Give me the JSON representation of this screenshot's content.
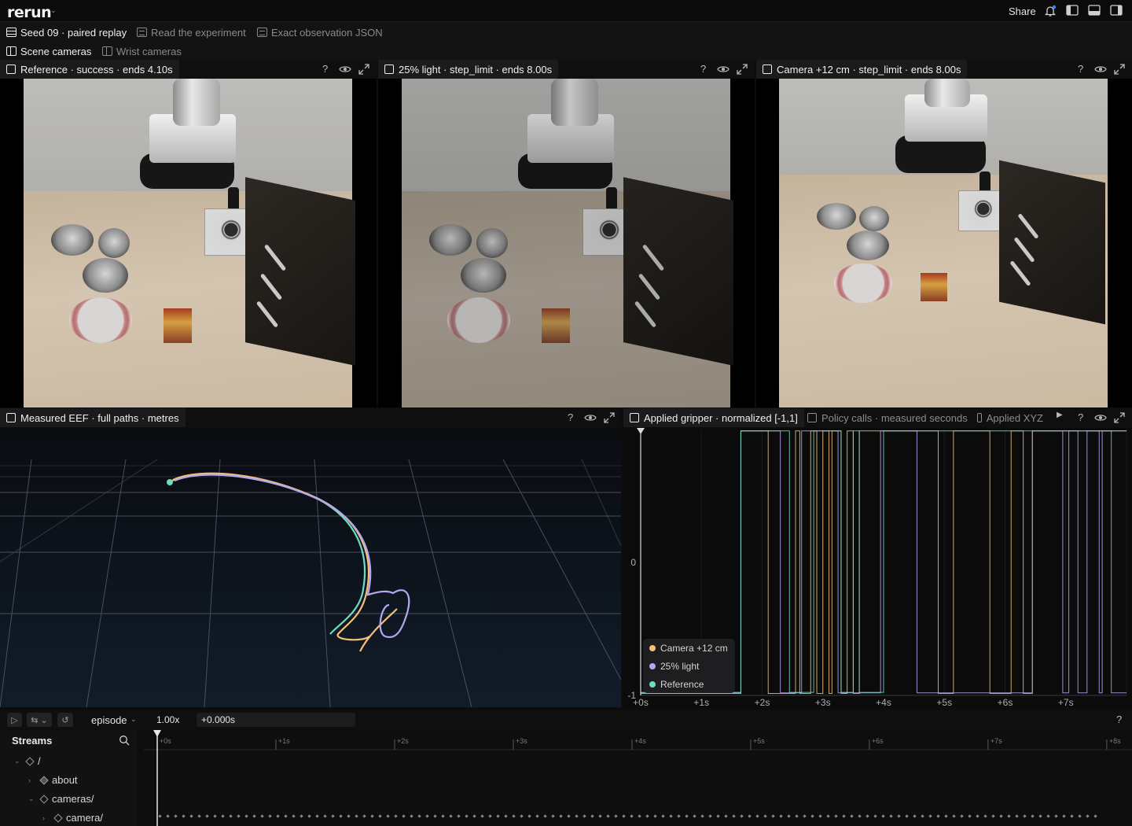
{
  "app": {
    "logo": "rerun",
    "share_label": "Share"
  },
  "tabs_row1": [
    {
      "label": "Seed 09 · paired replay",
      "active": true,
      "icon": "rows-icon"
    },
    {
      "label": "Read the experiment",
      "active": false,
      "icon": "document-icon"
    },
    {
      "label": "Exact observation JSON",
      "active": false,
      "icon": "document-icon"
    }
  ],
  "tabs_row2": [
    {
      "label": "Scene cameras",
      "active": true,
      "icon": "columns-icon"
    },
    {
      "label": "Wrist cameras",
      "active": false,
      "icon": "columns-icon"
    }
  ],
  "camera_views": [
    {
      "title": "Reference · success · ends 4.10s",
      "variant": "reference"
    },
    {
      "title": "25% light · step_limit · ends 8.00s",
      "variant": "dim"
    },
    {
      "title": "Camera +12 cm · step_limit · ends 8.00s",
      "variant": "shifted"
    }
  ],
  "view_controls": {
    "help": "?",
    "visibility": "eye-icon",
    "maximize": "expand-icon"
  },
  "eef_view": {
    "title": "Measured EEF · full paths · metres"
  },
  "plot_tabs": [
    {
      "label": "Applied gripper · normalized [-1,1]",
      "active": true
    },
    {
      "label": "Policy calls · measured seconds",
      "active": false
    },
    {
      "label": "Applied XYZ",
      "active": false
    }
  ],
  "chart_data": {
    "type": "line",
    "title": "Applied gripper · normalized [-1,1]",
    "y_ticks": [
      "0",
      "-1"
    ],
    "ylim": [
      -1,
      1
    ],
    "x_ticks": [
      "+0s",
      "+1s",
      "+2s",
      "+3s",
      "+4s",
      "+5s",
      "+6s",
      "+7s"
    ],
    "xlim": [
      0,
      8
    ],
    "series": [
      {
        "name": "Camera +12 cm",
        "color": "#f5c07a",
        "toggles": [
          1.65,
          2.1,
          2.55,
          2.62,
          2.8,
          2.9,
          3.0,
          3.1,
          3.15,
          3.3,
          3.4,
          3.5,
          3.6,
          4.9,
          5.15,
          5.75,
          6.1,
          6.3,
          6.45
        ]
      },
      {
        "name": "25% light",
        "color": "#b7a7f0",
        "toggles": [
          1.65,
          2.3,
          2.65,
          3.25,
          3.95,
          4.55,
          6.45,
          6.95,
          7.05,
          7.2,
          7.35,
          7.55,
          7.6,
          7.75
        ]
      },
      {
        "name": "Reference",
        "color": "#6fdcc0",
        "toggles": [
          1.65,
          2.45,
          2.85,
          3.3,
          3.5,
          3.6,
          4.0
        ]
      }
    ]
  },
  "time_panel": {
    "timeline_name": "episode",
    "speed": "1.00x",
    "time": "+0.000s",
    "ticks": [
      "+0s",
      "+1s",
      "+2s",
      "+3s",
      "+4s",
      "+5s",
      "+6s",
      "+7s",
      "+8s"
    ],
    "help": "?"
  },
  "streams": {
    "title": "Streams",
    "items": [
      {
        "label": "/",
        "depth": 0,
        "expanded": true
      },
      {
        "label": "about",
        "depth": 1,
        "expanded": false
      },
      {
        "label": "cameras/",
        "depth": 1,
        "expanded": true
      },
      {
        "label": "camera/",
        "depth": 2,
        "expanded": false
      }
    ]
  }
}
